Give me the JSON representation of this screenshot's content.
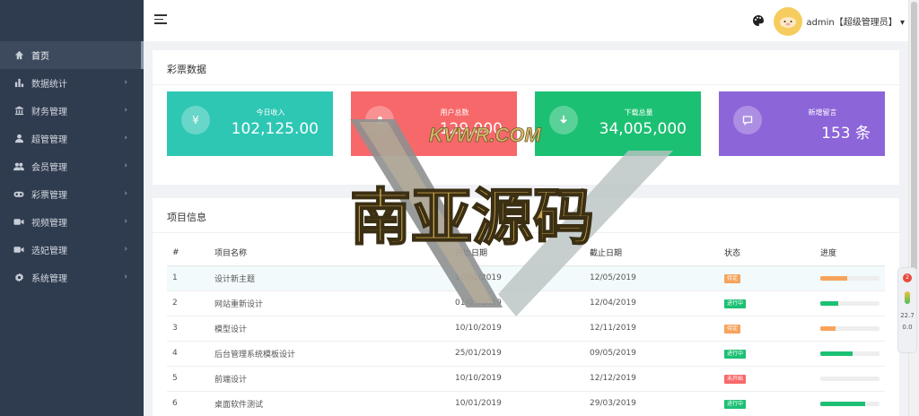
{
  "header": {
    "user": "admin【超级管理员】"
  },
  "sidebar": {
    "items": [
      {
        "label": "首页",
        "icon": "home-icon"
      },
      {
        "label": "数据统计",
        "icon": "bar-chart-icon"
      },
      {
        "label": "财务管理",
        "icon": "bank-icon"
      },
      {
        "label": "超管管理",
        "icon": "user-icon"
      },
      {
        "label": "会员管理",
        "icon": "users-icon"
      },
      {
        "label": "彩票管理",
        "icon": "gamepad-icon"
      },
      {
        "label": "视频管理",
        "icon": "video-icon"
      },
      {
        "label": "选妃管理",
        "icon": "video-icon"
      },
      {
        "label": "系统管理",
        "icon": "gear-icon"
      }
    ]
  },
  "lottery": {
    "title": "彩票数据",
    "cards": [
      {
        "label": "今日收入",
        "value": "102,125.00",
        "icon": "yen-icon",
        "color": "#2ec7b4"
      },
      {
        "label": "用户总数",
        "value": "129,000",
        "icon": "user-icon",
        "color": "#f7686a"
      },
      {
        "label": "下载总量",
        "value": "34,005,000",
        "icon": "download-icon",
        "color": "#1cc073"
      },
      {
        "label": "新增留言",
        "value": "153 条",
        "icon": "comment-icon",
        "color": "#8c65d9"
      }
    ]
  },
  "projects": {
    "title": "项目信息",
    "headers": [
      "#",
      "项目名称",
      "开始日期",
      "截止日期",
      "状态",
      "进度"
    ],
    "rows": [
      {
        "num": "1",
        "name": "设计新主题",
        "start": "10/02/2019",
        "end": "12/05/2019",
        "status": "待定",
        "status_color": "#f7a35c",
        "progress": 0.45,
        "progress_color": "#f7a35c"
      },
      {
        "num": "2",
        "name": "网站重新设计",
        "start": "01/03/2019",
        "end": "12/04/2019",
        "status": "进行中",
        "status_color": "#1cc073",
        "progress": 0.3,
        "progress_color": "#1cc073"
      },
      {
        "num": "3",
        "name": "模型设计",
        "start": "10/10/2019",
        "end": "12/11/2019",
        "status": "待定",
        "status_color": "#f7a35c",
        "progress": 0.25,
        "progress_color": "#f7a35c"
      },
      {
        "num": "4",
        "name": "后台管理系统模板设计",
        "start": "25/01/2019",
        "end": "09/05/2019",
        "status": "进行中",
        "status_color": "#1cc073",
        "progress": 0.55,
        "progress_color": "#1cc073"
      },
      {
        "num": "5",
        "name": "前端设计",
        "start": "10/10/2019",
        "end": "12/12/2019",
        "status": "未开始",
        "status_color": "#f7686a",
        "progress": 0,
        "progress_color": "#f7686a"
      },
      {
        "num": "6",
        "name": "桌面软件测试",
        "start": "10/01/2019",
        "end": "29/03/2019",
        "status": "进行中",
        "status_color": "#1cc073",
        "progress": 0.75,
        "progress_color": "#1cc073"
      }
    ]
  },
  "watermark": {
    "brand": "KVWR.COM",
    "text": "南亚源码"
  },
  "widget": {
    "badge": "2",
    "value1": "22.7",
    "value2": "0.0"
  }
}
